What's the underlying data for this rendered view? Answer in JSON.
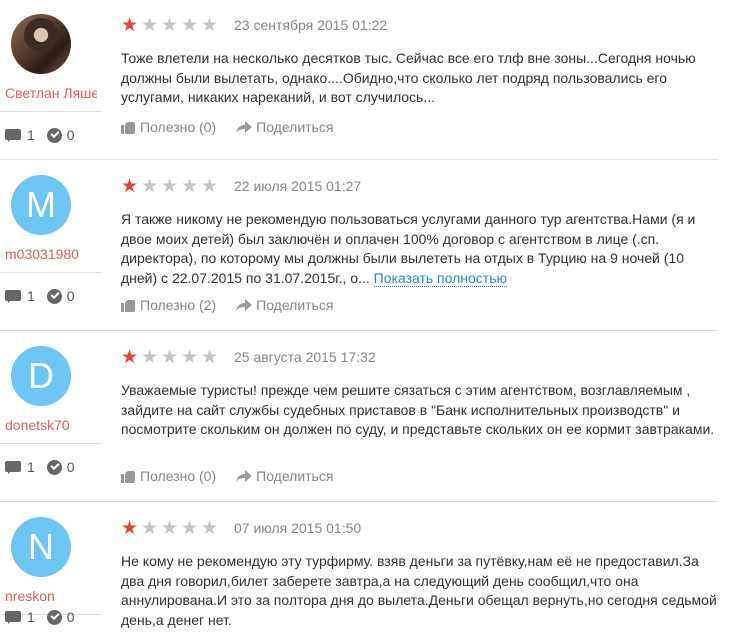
{
  "reviews": [
    {
      "avatar_letter": "",
      "avatar_type": "photo",
      "username": "Светлан Ляшенко",
      "comments": "1",
      "confirms": "0",
      "rating": 1,
      "date": "23 сентября 2015 01:22",
      "text": "Тоже влетели на несколько десятков тыс. Сейчас все его тлф вне зоны...Сегодня ночью должны были вылетать, однако....Обидно,что сколько лет подряд пользовались его услугами, никаких нареканий, и вот случилось...",
      "more": "",
      "useful": "Полезно (0)",
      "share": "Поделиться"
    },
    {
      "avatar_letter": "M",
      "avatar_type": "letter",
      "username": "m03031980",
      "comments": "1",
      "confirms": "0",
      "rating": 1,
      "date": "22 июля 2015 01:27",
      "text": "Я также никому не рекомендую пользоваться услугами данного тур агентства.Нами (я и двое моих детей) был заключён и оплачен 100% договор с агентством в лице                     (.сп. директора), по которому мы должны были вылететь на отдых в Турцию на 9 ночей (10 дней) с 22.07.2015 по 31.07.2015г., о...",
      "more": "Показать полностью",
      "useful": "Полезно (2)",
      "share": "Поделиться"
    },
    {
      "avatar_letter": "D",
      "avatar_type": "letter",
      "username": "donetsk70",
      "comments": "1",
      "confirms": "0",
      "rating": 1,
      "date": "25 августа 2015 17:32",
      "text": "Уважаемые туристы! прежде чем решите сязаться с этим агентством, возглавляемым                          , зайдите на сайт службы судебных приставов в \"Банк исполнительных производств\" и посмотрите скольким он должен по суду, и представьте скольких он ее кормит завтраками.",
      "more": "",
      "useful": "Полезно (0)",
      "share": "Поделиться"
    },
    {
      "avatar_letter": "N",
      "avatar_type": "letter",
      "username": "nreskon",
      "comments": "1",
      "confirms": "0",
      "rating": 1,
      "date": "07 июля 2015 01:50",
      "text": "Не кому не рекомендую эту турфирму.            взяв деньги за путёвку,нам её не предоставил.За два дня говорил,билет заберете завтра,а на следующий день сообщил,что она аннулирована.И это за полтора дня до вылета.Деньги обещал вернуть,но сегодня седьмой день,а денег нет.",
      "more": "",
      "useful": "",
      "share": ""
    }
  ]
}
